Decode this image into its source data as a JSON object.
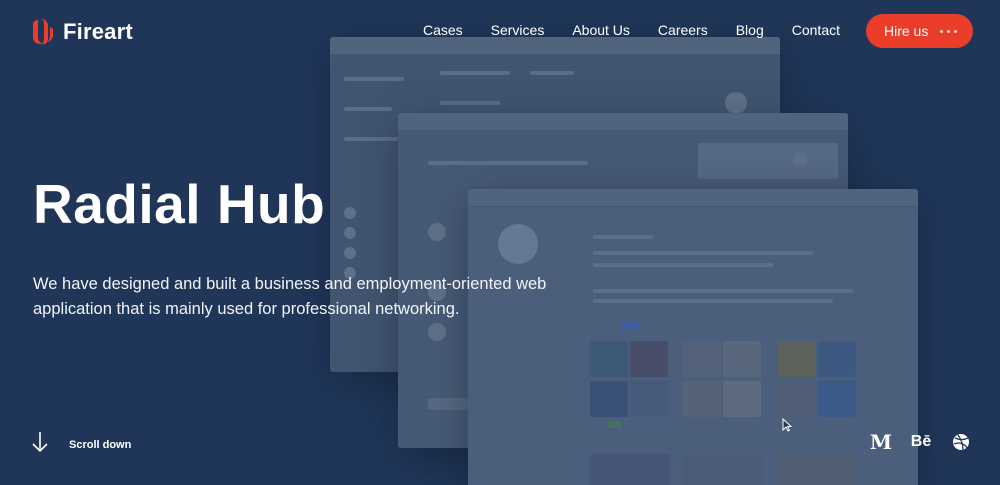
{
  "brand": {
    "name": "Fireart",
    "accent": "#ea3d2a",
    "background": "#22395b"
  },
  "nav": {
    "items": [
      {
        "label": "Cases"
      },
      {
        "label": "Services"
      },
      {
        "label": "About Us"
      },
      {
        "label": "Careers"
      },
      {
        "label": "Blog"
      },
      {
        "label": "Contact"
      }
    ],
    "cta": {
      "label": "Hire us"
    }
  },
  "hero": {
    "title": "Radial Hub",
    "description": "We have designed and built a business and employment-oriented web application that is mainly used for professional networking."
  },
  "scroll": {
    "label": "Scroll down",
    "icon": "arrow-down-icon"
  },
  "social": [
    {
      "name": "medium-icon",
      "glyph": "M"
    },
    {
      "name": "behance-icon",
      "glyph": "Bē"
    },
    {
      "name": "dribbble-icon",
      "glyph": ""
    }
  ]
}
